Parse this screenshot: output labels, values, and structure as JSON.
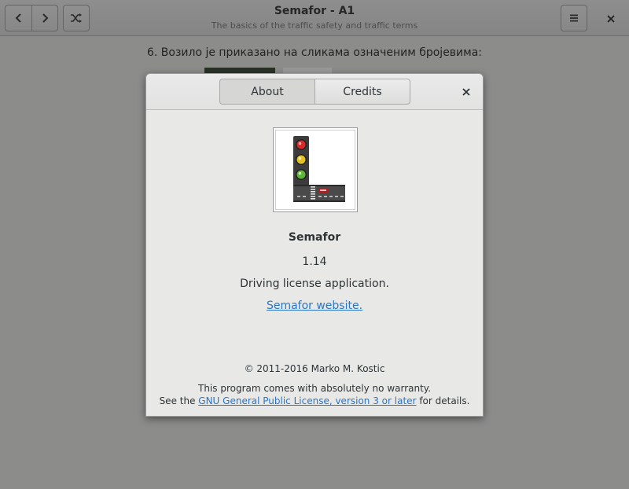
{
  "window": {
    "title": "Semafor - A1",
    "subtitle": "The basics of the traffic safety and traffic terms"
  },
  "toolbar": {
    "back_icon": "chevron-left-icon",
    "forward_icon": "chevron-right-icon",
    "shuffle_icon": "shuffle-icon",
    "menu_icon": "hamburger-menu-icon",
    "close_icon": "close-icon"
  },
  "content": {
    "question": "6. Возило је приказано на сликама означеним бројевима:"
  },
  "about_dialog": {
    "tabs": [
      {
        "label": "About",
        "active": true
      },
      {
        "label": "Credits",
        "active": false
      }
    ],
    "logo_icon": "traffic-light-logo-icon",
    "app_name": "Semafor",
    "version": "1.14",
    "comment": "Driving license application.",
    "website_label": "Semafor website.",
    "copyright": "© 2011-2016 Marko M. Kostic",
    "license_line1": "This program comes with absolutely no warranty.",
    "license_prefix": "See the",
    "license_link": "GNU General Public License, version 3 or later",
    "license_suffix": "for details."
  },
  "colors": {
    "link": "#2a76c6",
    "overlay_background": "#8c8c8b",
    "dialog_background": "#e8e8e7"
  }
}
